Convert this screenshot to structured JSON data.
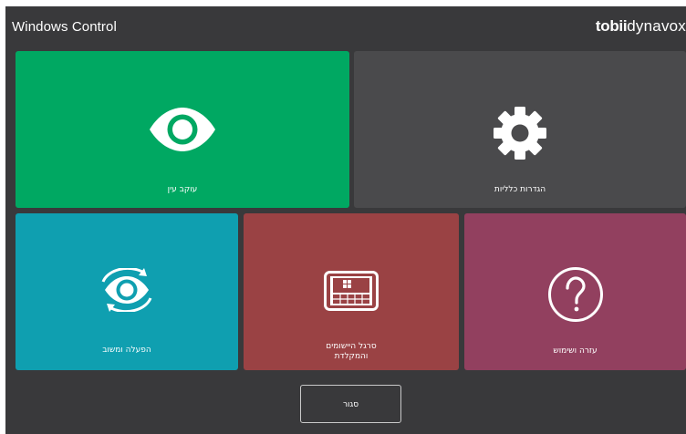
{
  "window": {
    "title": "Windows Control",
    "brand_bold": "tobii",
    "brand_light": "dynavox"
  },
  "tiles": [
    {
      "id": "eye-tracking",
      "label": "עוקב עין",
      "icon": "eye-icon",
      "color": "#00a862"
    },
    {
      "id": "general-settings",
      "label": "הגדרות כלליות",
      "icon": "gear-icon",
      "color": "#4a4a4c"
    },
    {
      "id": "activation-and-feedback",
      "label": "הפעלה ומשוב",
      "icon": "eye-refresh-icon",
      "color": "#0f9fb0"
    },
    {
      "id": "appbar-and-keyboard",
      "label_line1": "סרגל היישומים",
      "label_line2": "והמקלדת",
      "icon": "keyboard-window-icon",
      "color": "#9a4244"
    },
    {
      "id": "help-and-usage",
      "label": "עזרה ושימוש",
      "icon": "question-icon",
      "color": "#92405f"
    }
  ],
  "footer": {
    "close_label": "סגור"
  },
  "colors": {
    "background": "#39393b",
    "text": "#ffffff"
  }
}
